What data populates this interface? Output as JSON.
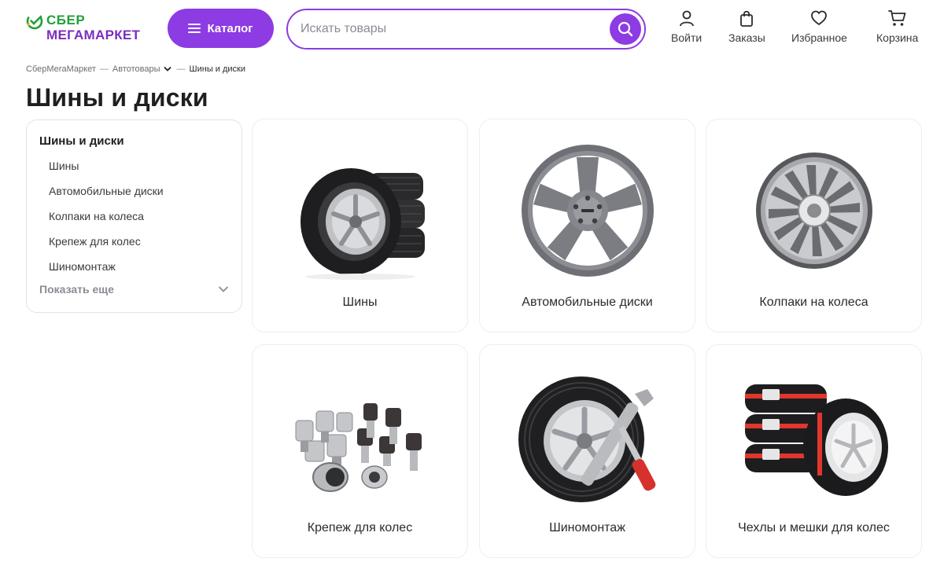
{
  "logo": {
    "line1": "СБЕР",
    "line2": "МЕГАМАРКЕТ"
  },
  "header": {
    "catalog_label": "Каталог",
    "search_placeholder": "Искать товары",
    "actions": [
      {
        "label": "Войти",
        "icon": "user-icon"
      },
      {
        "label": "Заказы",
        "icon": "bag-icon"
      },
      {
        "label": "Избранное",
        "icon": "heart-icon"
      },
      {
        "label": "Корзина",
        "icon": "cart-icon"
      }
    ]
  },
  "breadcrumb": {
    "items": [
      "СберМегаМаркет",
      "Автотовары",
      "Шины и диски"
    ],
    "separator": "—"
  },
  "page": {
    "title": "Шины и диски"
  },
  "sidebar": {
    "heading": "Шины и диски",
    "items": [
      "Шины",
      "Автомобильные диски",
      "Колпаки на колеса",
      "Крепеж для колес",
      "Шиномонтаж"
    ],
    "show_more": "Показать еще"
  },
  "categories": [
    {
      "label": "Шины",
      "icon": "tires-icon"
    },
    {
      "label": "Автомобильные диски",
      "icon": "alloy-wheel-icon"
    },
    {
      "label": "Колпаки на колеса",
      "icon": "hubcap-icon"
    },
    {
      "label": "Крепеж для колес",
      "icon": "wheel-bolts-icon"
    },
    {
      "label": "Шиномонтаж",
      "icon": "tire-service-icon"
    },
    {
      "label": "Чехлы и мешки для колес",
      "icon": "tire-covers-icon"
    }
  ],
  "colors": {
    "accent": "#8d3be2",
    "brand_green": "#21a038",
    "brand_purple": "#7b2fbe"
  }
}
